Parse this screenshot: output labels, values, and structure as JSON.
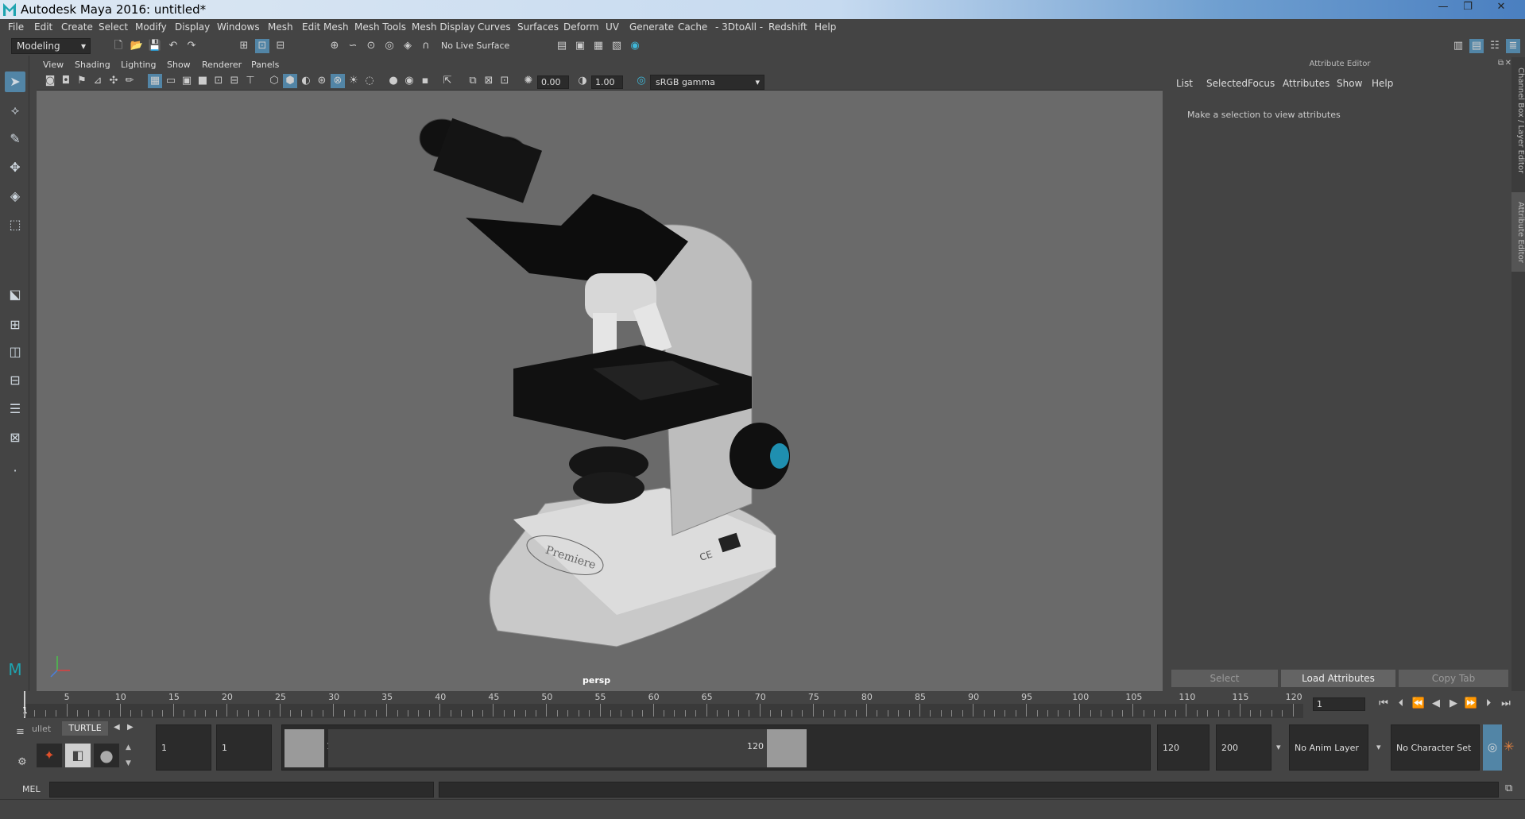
{
  "window": {
    "title": "Autodesk Maya 2016: untitled*",
    "controls": [
      "—",
      "❐",
      "✕"
    ]
  },
  "menubar": [
    "File",
    "Edit",
    "Create",
    "Select",
    "Modify",
    "Display",
    "Windows",
    "Mesh",
    "Edit Mesh",
    "Mesh Tools",
    "Mesh Display",
    "Curves",
    "Surfaces",
    "Deform",
    "UV",
    "Generate",
    "Cache",
    "- 3DtoAll -",
    "Redshift",
    "Help"
  ],
  "statusline": {
    "mode": "Modeling",
    "live_surface": "No Live Surface"
  },
  "panel_menu": [
    "View",
    "Shading",
    "Lighting",
    "Show",
    "Renderer",
    "Panels"
  ],
  "panel_toolbar": {
    "exposure": "0.00",
    "gamma": "1.00",
    "color_space": "sRGB gamma"
  },
  "viewport": {
    "camera_label": "persp",
    "model_logo": "Premiere",
    "model_mark": "CE"
  },
  "attribute_editor": {
    "header": "Attribute Editor",
    "menu": [
      "List",
      "Selected",
      "Focus",
      "Attributes",
      "Show",
      "Help"
    ],
    "message": "Make a selection to view attributes",
    "buttons": [
      "Select",
      "Load Attributes",
      "Copy Tab"
    ]
  },
  "side_tabs": [
    "Channel Box / Layer Editor",
    "Attribute Editor"
  ],
  "timeline": {
    "ticks": [
      "5",
      "10",
      "15",
      "20",
      "25",
      "30",
      "35",
      "40",
      "45",
      "50",
      "55",
      "60",
      "65",
      "70",
      "75",
      "80",
      "85",
      "90",
      "95",
      "100",
      "105",
      "110",
      "115",
      "120"
    ],
    "current_frame_label": "1",
    "current_time": "1"
  },
  "range": {
    "shelf_tab_prev": "ullet",
    "shelf_tab": "TURTLE",
    "start": "1",
    "playback_start": "1",
    "slider_start": "1",
    "slider_end": "120",
    "playback_end": "120",
    "end": "200",
    "anim_layer": "No Anim Layer",
    "character_set": "No Character Set"
  },
  "mel": {
    "label": "MEL"
  },
  "colors": {
    "accent": "#5285a6",
    "viewport_bg": "#6a6a6a",
    "panel": "#444444",
    "field": "#2b2b2b"
  }
}
